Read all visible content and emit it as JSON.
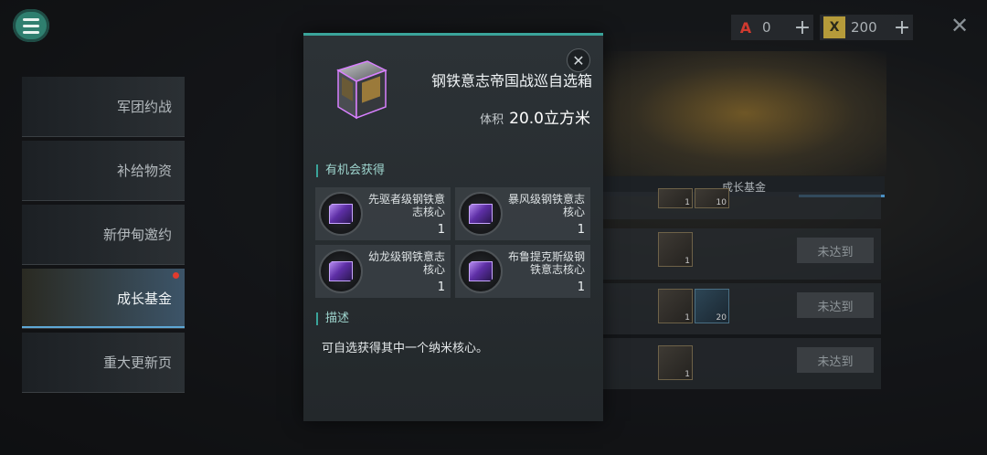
{
  "currencies": [
    {
      "icon": "A",
      "icon_name": "alliance-credit-icon",
      "value": "0"
    },
    {
      "icon": "X",
      "icon_name": "gold-token-icon",
      "value": "200"
    }
  ],
  "plus_glyph": "+",
  "close_glyph": "✕",
  "sidebar": {
    "items": [
      {
        "label": "军团约战"
      },
      {
        "label": "补给物资"
      },
      {
        "label": "新伊甸邀约"
      },
      {
        "label": "成长基金"
      },
      {
        "label": "重大更新页"
      }
    ]
  },
  "fund": {
    "header": "成长基金",
    "row1_counts": [
      "1",
      "10"
    ],
    "rows": [
      {
        "counts": [
          "1"
        ],
        "button": "未达到"
      },
      {
        "counts": [
          "1",
          "20"
        ],
        "button": "未达到"
      },
      {
        "counts": [
          "1"
        ],
        "button": "未达到"
      }
    ]
  },
  "popup": {
    "title": "钢铁意志帝国战巡自选箱",
    "volume_label": "体积",
    "volume_value": "20.0立方米",
    "rewards_label": "有机会获得",
    "rewards": [
      {
        "name": "先驱者级钢铁意志核心",
        "count": "1"
      },
      {
        "name": "暴风级钢铁意志核心",
        "count": "1"
      },
      {
        "name": "幼龙级钢铁意志核心",
        "count": "1"
      },
      {
        "name": "布鲁提克斯级钢铁意志核心",
        "count": "1"
      }
    ],
    "description_label": "描述",
    "description": "可自选获得其中一个纳米核心。"
  }
}
